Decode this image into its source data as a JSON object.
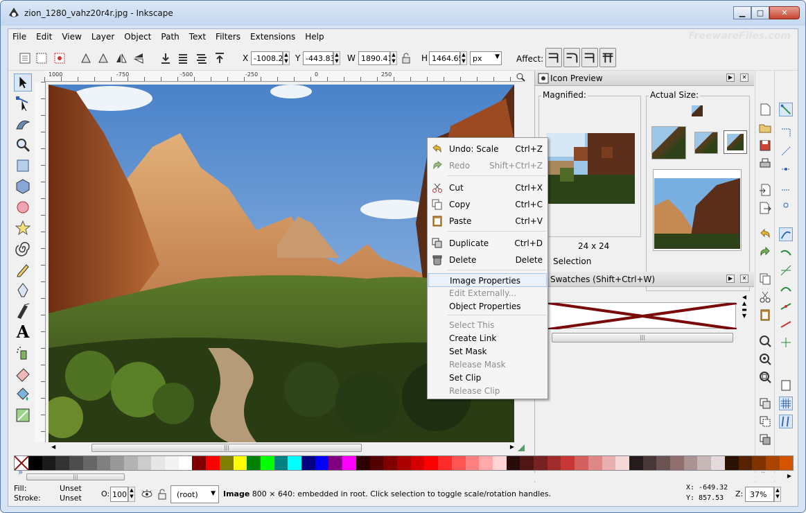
{
  "window": {
    "title": "zion_1280_vahz20r4r.jpg - Inkscape",
    "min": "▁",
    "max": "□",
    "close": "✕",
    "watermark": "FreewareFiles.com"
  },
  "menu": [
    "File",
    "Edit",
    "View",
    "Layer",
    "Object",
    "Path",
    "Text",
    "Filters",
    "Extensions",
    "Help"
  ],
  "toolbar": {
    "x_label": "X",
    "x_value": "-1008.2",
    "y_label": "Y",
    "y_value": "-443.83(",
    "w_label": "W",
    "w_value": "1890.41",
    "h_label": "H",
    "h_value": "1464.65",
    "unit": "px",
    "affect_label": "Affect:"
  },
  "ruler": {
    "h_labels": [
      "1000",
      "-750",
      "-500",
      "-250",
      "0",
      "250"
    ],
    "v_labels": [
      "0",
      "2",
      "5",
      "0",
      "0",
      "2",
      "5",
      "0",
      "5",
      "0",
      "0"
    ]
  },
  "context_menu": [
    {
      "label": "Undo: Scale",
      "shortcut": "Ctrl+Z",
      "enabled": true,
      "icon": "undo-icon"
    },
    {
      "label": "Redo",
      "shortcut": "Shift+Ctrl+Z",
      "enabled": false,
      "icon": "redo-icon"
    },
    {
      "label": "Cut",
      "shortcut": "Ctrl+X",
      "enabled": true,
      "icon": "scissors-icon"
    },
    {
      "label": "Copy",
      "shortcut": "Ctrl+C",
      "enabled": true,
      "icon": "copy-icon"
    },
    {
      "label": "Paste",
      "shortcut": "Ctrl+V",
      "enabled": true,
      "icon": "paste-icon"
    },
    {
      "label": "Duplicate",
      "shortcut": "Ctrl+D",
      "enabled": true,
      "icon": "duplicate-icon"
    },
    {
      "label": "Delete",
      "shortcut": "Delete",
      "enabled": true,
      "icon": "trash-icon"
    },
    {
      "label": "Image Properties",
      "shortcut": "",
      "enabled": true,
      "highlighted": true
    },
    {
      "label": "Edit Externally...",
      "shortcut": "",
      "enabled": false
    },
    {
      "label": "Object Properties",
      "shortcut": "",
      "enabled": true
    },
    {
      "label": "Select This",
      "shortcut": "",
      "enabled": false
    },
    {
      "label": "Create Link",
      "shortcut": "",
      "enabled": true
    },
    {
      "label": "Set Mask",
      "shortcut": "",
      "enabled": true
    },
    {
      "label": "Release Mask",
      "shortcut": "",
      "enabled": false
    },
    {
      "label": "Set Clip",
      "shortcut": "",
      "enabled": true
    },
    {
      "label": "Release Clip",
      "shortcut": "",
      "enabled": false
    }
  ],
  "icon_preview": {
    "title": "Icon Preview",
    "magnified": "Magnified:",
    "actual": "Actual Size:",
    "size": "24 x 24",
    "selection": "Selection"
  },
  "swatches": {
    "title": "Swatches (Shift+Ctrl+W)"
  },
  "palette": [
    "#000000",
    "#1a1a1a",
    "#333333",
    "#4d4d4d",
    "#666666",
    "#808080",
    "#999999",
    "#b3b3b3",
    "#cccccc",
    "#e6e6e6",
    "#f2f2f2",
    "#ffffff",
    "#800000",
    "#ff0000",
    "#808000",
    "#ffff00",
    "#008000",
    "#00ff00",
    "#008080",
    "#00ffff",
    "#000080",
    "#0000ff",
    "#800080",
    "#ff00ff",
    "#2b0000",
    "#550000",
    "#800000",
    "#aa0000",
    "#d40000",
    "#ff0000",
    "#ff2a2a",
    "#ff5555",
    "#ff8080",
    "#ffaaaa",
    "#ffd5d5",
    "#280b0b",
    "#501616",
    "#782121",
    "#a02c2c",
    "#c83737",
    "#d35f5f",
    "#de8787",
    "#e9afaf",
    "#f4d7d7",
    "#241c1c",
    "#483737",
    "#6c5353",
    "#916f6f",
    "#ac9393",
    "#c8b7b7",
    "#e3dbdb",
    "#2b1100",
    "#552200",
    "#803300",
    "#aa4400",
    "#d45500"
  ],
  "status": {
    "fill_label": "Fill:",
    "fill_value": "Unset",
    "stroke_label": "Stroke:",
    "stroke_value": "Unset",
    "opacity_label": "O:",
    "opacity_value": "100",
    "layer": "(root)",
    "message_bold": "Image",
    "message": " 800 × 640: embedded in root. Click selection to toggle scale/rotation handles.",
    "x_coord": "X: -649.32",
    "y_coord": "Y:  857.53",
    "zoom_label": "Z:",
    "zoom": "37%"
  }
}
